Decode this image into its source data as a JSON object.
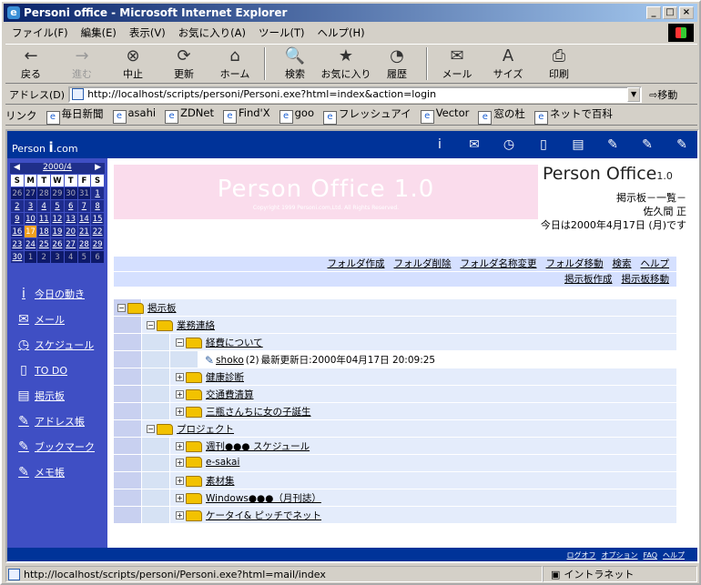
{
  "window": {
    "title": "Personi office - Microsoft Internet Explorer"
  },
  "menu": [
    "ファイル(F)",
    "編集(E)",
    "表示(V)",
    "お気に入り(A)",
    "ツール(T)",
    "ヘルプ(H)"
  ],
  "toolbar": [
    {
      "label": "戻る",
      "icon": "←"
    },
    {
      "label": "進む",
      "icon": "→"
    },
    {
      "label": "中止",
      "icon": "⊗"
    },
    {
      "label": "更新",
      "icon": "⟳"
    },
    {
      "label": "ホーム",
      "icon": "⌂"
    },
    {
      "label": "検索",
      "icon": "🔍"
    },
    {
      "label": "お気に入り",
      "icon": "★"
    },
    {
      "label": "履歴",
      "icon": "◔"
    },
    {
      "label": "メール",
      "icon": "✉"
    },
    {
      "label": "サイズ",
      "icon": "A"
    },
    {
      "label": "印刷",
      "icon": "⎙"
    }
  ],
  "address": {
    "label": "アドレス(D)",
    "url": "http://localhost/scripts/personi/Personi.exe?html=index&action=login",
    "go": "移動"
  },
  "links": {
    "label": "リンク",
    "items": [
      "毎日新聞",
      "asahi",
      "ZDNet",
      "Find'X",
      "goo",
      "フレッシュアイ",
      "Vector",
      "窓の杜",
      "ネットで百科"
    ]
  },
  "site": {
    "brand_prefix": "Person",
    "brand_suffix": ".com"
  },
  "calendar": {
    "month": "2000/4",
    "weekdays": [
      "S",
      "M",
      "T",
      "W",
      "T",
      "F",
      "S"
    ],
    "weeks": [
      [
        "26",
        "27",
        "28",
        "29",
        "30",
        "31",
        "1"
      ],
      [
        "2",
        "3",
        "4",
        "5",
        "6",
        "7",
        "8"
      ],
      [
        "9",
        "10",
        "11",
        "12",
        "13",
        "14",
        "15"
      ],
      [
        "16",
        "17",
        "18",
        "19",
        "20",
        "21",
        "22"
      ],
      [
        "23",
        "24",
        "25",
        "26",
        "27",
        "28",
        "29"
      ],
      [
        "30",
        "1",
        "2",
        "3",
        "4",
        "5",
        "6"
      ]
    ]
  },
  "sidenav": [
    {
      "label": "今日の動き",
      "icon": "i"
    },
    {
      "label": "メール",
      "icon": "✉"
    },
    {
      "label": "スケジュール",
      "icon": "◷"
    },
    {
      "label": "TO DO",
      "icon": "▯"
    },
    {
      "label": "掲示板",
      "icon": "▤"
    },
    {
      "label": "アドレス帳",
      "icon": "✎"
    },
    {
      "label": "ブックマーク",
      "icon": "✎"
    },
    {
      "label": "メモ帳",
      "icon": "✎"
    }
  ],
  "banner": {
    "title": "Person Office 1.0",
    "copyright": "Copyright 1999 Personi.com,Ltd.  All Rights Reserved."
  },
  "logo": {
    "text": "Person Office",
    "version": "1.0"
  },
  "page": {
    "title": "掲示板－一覧－",
    "user": "佐久間 正",
    "today": "今日は2000年4月17日 (月)です"
  },
  "actions1": [
    "フォルダ作成",
    "フォルダ削除",
    "フォルダ名称変更",
    "フォルダ移動",
    "検索",
    "ヘルプ"
  ],
  "actions2": [
    "掲示板作成",
    "掲示板移動"
  ],
  "tree": {
    "root": "掲示板",
    "g1": "業務連絡",
    "g1a": "経費について",
    "post_author": "shoko",
    "post_count": "(2)",
    "post_updated": "最新更新日:2000年04月17日 20:09:25",
    "g1b": "健康診断",
    "g1c": "交通費清算",
    "g1d": "三瓶さんちに女の子誕生",
    "g2": "プロジェクト",
    "g2a": "週刊●●● スケジュール",
    "g2b": "e-sakai",
    "g2c": "素材集",
    "g2d": "Windows●●●（月刊誌）",
    "g2e": "ケータイ& ピッチでネット"
  },
  "footer": [
    "ログオフ",
    "オプション",
    "FAQ",
    "ヘルプ"
  ],
  "status": {
    "url": "http://localhost/scripts/personi/Personi.exe?html=mail/index",
    "zone": "イントラネット"
  }
}
